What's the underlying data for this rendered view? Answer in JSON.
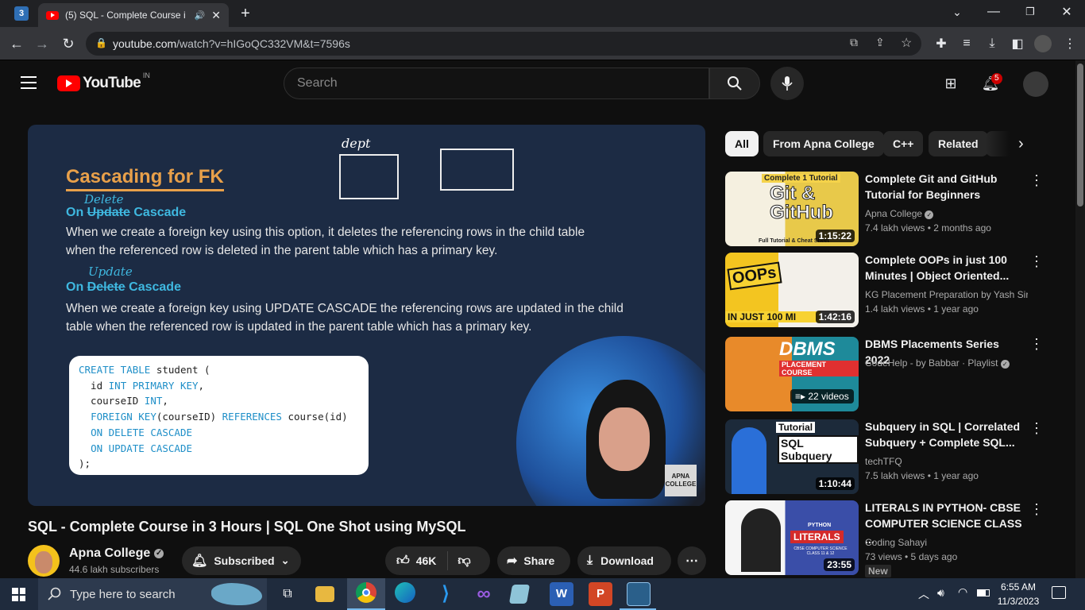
{
  "browser": {
    "tab_title": "(5) SQL - Complete Course i",
    "url_host": "youtube.com",
    "url_path": "/watch?v=hIGoQC332VM&t=7596s"
  },
  "header": {
    "logo_text": "YouTube",
    "region": "IN",
    "search_placeholder": "Search",
    "notifications_count": "5"
  },
  "slide": {
    "title": "Cascading for FK",
    "dept_label": "dept",
    "h1_on": "On",
    "h1_struck": "Update",
    "h1_handwritten": "Delete",
    "h1_cascade": "Cascade",
    "p1_line1": "When we create a foreign key using this option, it deletes the referencing rows in the child table",
    "p1_line2": "when the referenced row is deleted in the parent table which has a primary key.",
    "h2_on": "On",
    "h2_struck": "Delete",
    "h2_handwritten": "Update",
    "h2_cascade": "Cascade",
    "p2_line1": "When we create a foreign key using UPDATE CASCADE the referencing rows are updated in the child",
    "p2_line2": "table when the referenced row is updated in the parent table which has a primary key.",
    "watermark": "APNA COLLEGE"
  },
  "code": {
    "l1_kw": "CREATE TABLE",
    "l1_rest": " student (",
    "l2_pre": "  id ",
    "l2_kw": "INT PRIMARY KEY",
    "l2_post": ",",
    "l3_pre": "  courseID ",
    "l3_kw": "INT",
    "l3_post": ",",
    "l4_kw1": "FOREIGN KEY",
    "l4_mid": "(courseID) ",
    "l4_kw2": "REFERENCES",
    "l4_post": " course(id)",
    "l5_kw": "ON DELETE CASCADE",
    "l6_kw": "ON UPDATE CASCADE",
    "l7": ");"
  },
  "video": {
    "title": "SQL - Complete Course in 3 Hours | SQL One Shot using MySQL",
    "channel": "Apna College",
    "subscribers": "44.6 lakh subscribers",
    "subscribed_label": "Subscribed",
    "likes": "46K",
    "share_label": "Share",
    "download_label": "Download"
  },
  "chips": [
    "All",
    "From Apna College",
    "C++",
    "Related"
  ],
  "recommendations": [
    {
      "title_l1": "Complete Git and GitHub",
      "title_l2": "Tutorial for Beginners",
      "channel": "Apna College",
      "meta": "7.4 lakh views  • 2 months ago",
      "duration": "1:15:22",
      "thumb_text": "Git & GitHub",
      "thumb_sub": "Complete 1 Tutorial",
      "thumb_foot": "Full Tutorial & Cheat Sheet"
    },
    {
      "title_l1": "Complete OOPs in just 100",
      "title_l2": "Minutes | Object Oriented...",
      "channel": "KG Placement Preparation by Yash Sir",
      "meta": "1.4 lakh views  • 1 year ago",
      "duration": "1:42:16",
      "thumb_text": "OOPs",
      "thumb_foot": "IN JUST 100 MI"
    },
    {
      "title_l1": "DBMS Placements Series 2022",
      "title_l2": "",
      "channel": "CodeHelp - by Babbar · Playlist",
      "meta": "",
      "duration": "22 videos",
      "thumb_text": "DBMS",
      "thumb_sub": "PLACEMENT COURSE"
    },
    {
      "title_l1": "Subquery in SQL | Correlated",
      "title_l2": "Subquery + Complete SQL...",
      "channel": "techTFQ",
      "meta": "7.5 lakh views  • 1 year ago",
      "duration": "1:10:44",
      "thumb_text": "SQL Subquery",
      "thumb_sub": "Tutorial"
    },
    {
      "title_l1": "LITERALS IN PYTHON- CBSE",
      "title_l2": "COMPUTER SCIENCE CLASS ...",
      "channel": "Coding Sahayi",
      "meta": "73 views  • 5 days ago",
      "duration": "23:55",
      "thumb_text": "LITERALS",
      "thumb_sub": "PYTHON",
      "thumb_foot": "CBSE COMPUTER SCIENCE CLASS 11 & 12",
      "badge": "New"
    }
  ],
  "taskbar": {
    "search_placeholder": "Type here to search",
    "time": "6:55 AM",
    "date": "11/3/2023"
  }
}
